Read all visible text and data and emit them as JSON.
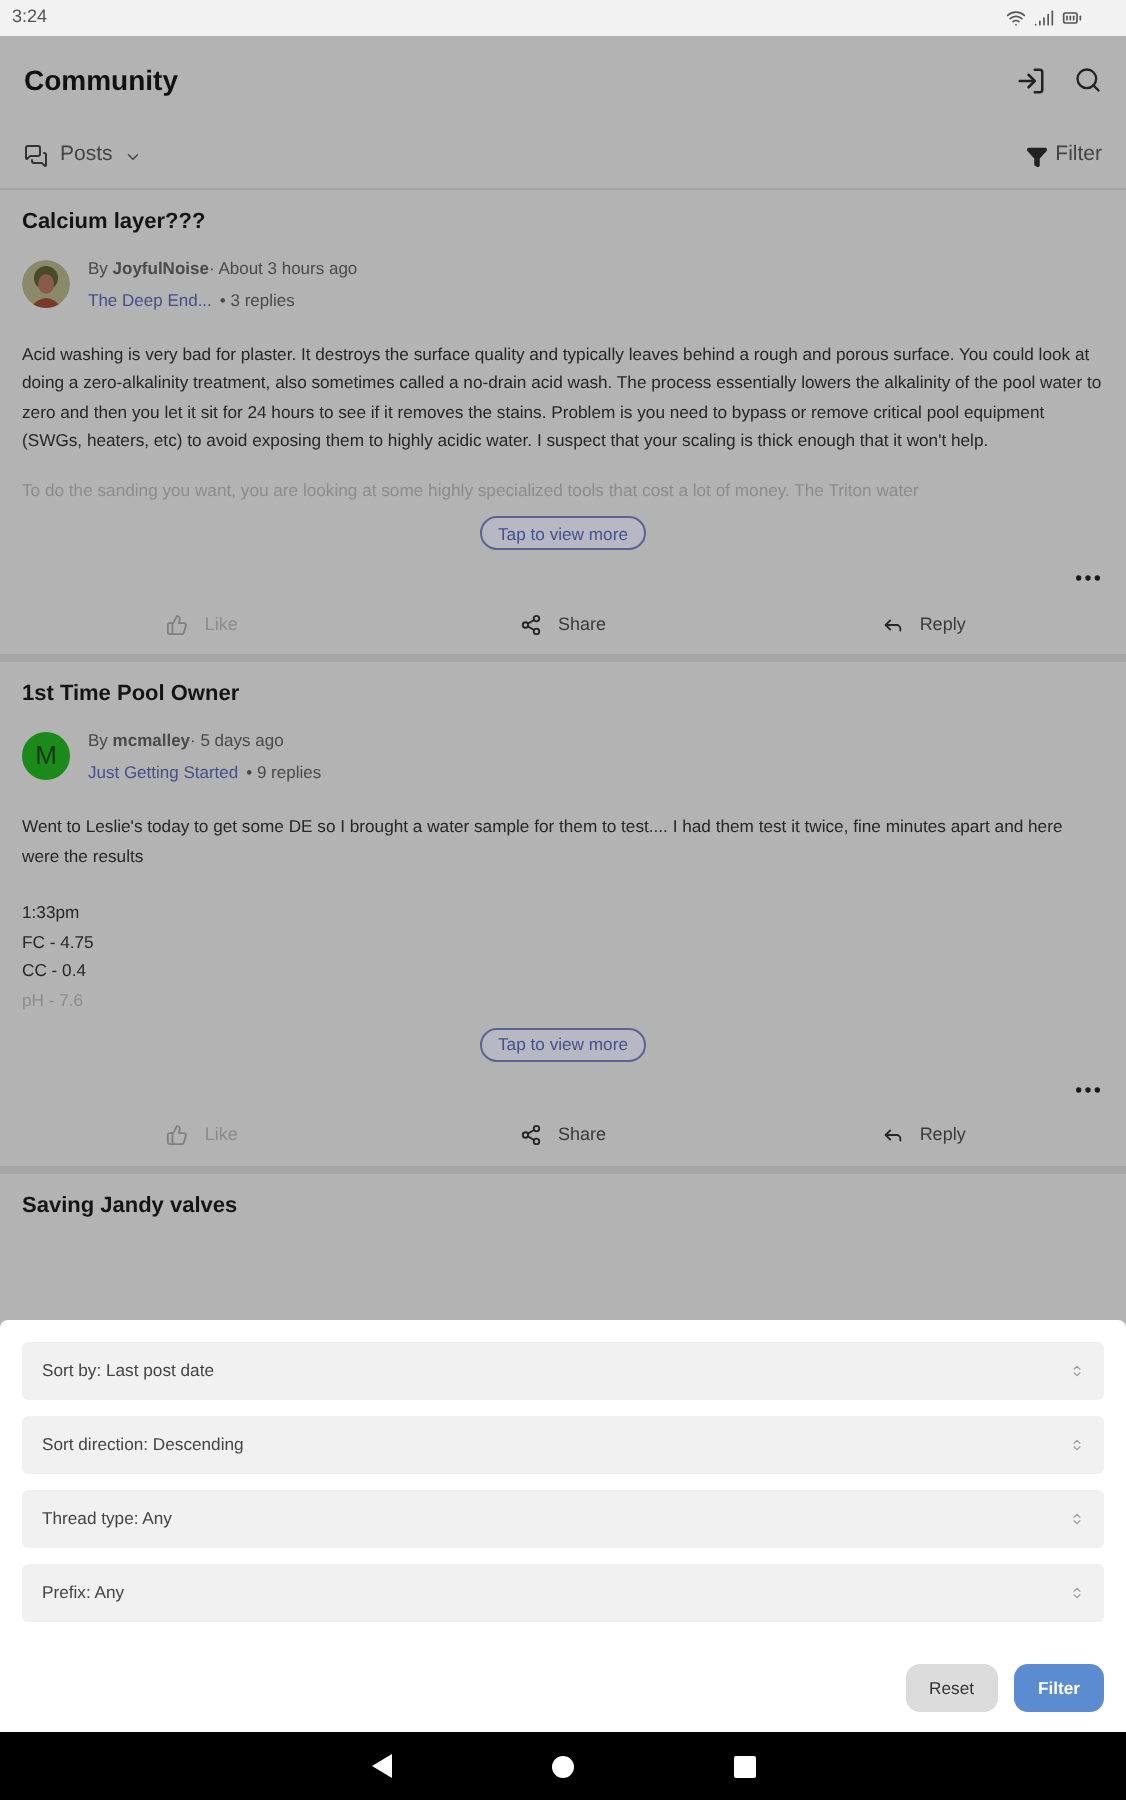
{
  "status_bar": {
    "time": "3:24"
  },
  "app_bar": {
    "title": "Community"
  },
  "toolbar": {
    "view_label": "Posts",
    "filter_label": "Filter"
  },
  "posts": [
    {
      "title": "Calcium layer???",
      "avatar": {
        "kind": "picture"
      },
      "meta": "By **JoyfulNoise**· About 3 hours ago",
      "forum": "The Deep End...",
      "replies": "• 3 replies",
      "paragraphs": [
        "Acid washing is very bad for plaster. It destroys the surface quality and typically leaves behind a rough and porous surface. You could look at doing a zero-alkalinity treatment, also sometimes called a no-drain acid wash. The process essentially lowers the alkalinity of the pool water to zero and then you let it sit for 24 hours to see if it removes the stains. Problem is you need to bypass or remove critical pool equipment (SWGs, heaters, etc) to avoid exposing them to highly acidic water. I suspect that your scaling is thick enough that it won't help."
      ],
      "faded_lines": [
        "To do the sanding you want, you are looking at some highly specialized tools that cost a lot of money. The Triton water"
      ],
      "more_label": "Tap to view more",
      "actions": [
        {
          "kind": "like",
          "label": "Like",
          "disabled": true
        },
        {
          "kind": "share",
          "label": "Share",
          "disabled": false
        },
        {
          "kind": "reply",
          "label": "Reply",
          "disabled": false
        }
      ]
    },
    {
      "title": "1st Time Pool Owner",
      "avatar": {
        "kind": "letter",
        "letter": "M",
        "color": "#1b8a1b"
      },
      "meta": "By **mcmalley**· 5 days ago",
      "forum": "Just Getting Started",
      "replies": "• 9 replies",
      "paragraphs": [
        "Went to Leslie's today to get some DE so I brought a water sample for them to test.... I had them test it twice, fine minutes apart and here were the results"
      ],
      "lines": [
        "1:33pm",
        "FC - 4.75",
        "CC - 0.4"
      ],
      "faded_lines": [
        "pH - 7.6"
      ],
      "more_label": "Tap to view more",
      "actions": [
        {
          "kind": "like",
          "label": "Like",
          "disabled": true
        },
        {
          "kind": "share",
          "label": "Share",
          "disabled": false
        },
        {
          "kind": "reply",
          "label": "Reply",
          "disabled": false
        }
      ]
    },
    {
      "title": "Saving Jandy valves"
    }
  ],
  "filter_sheet": {
    "selects": [
      {
        "label": "Sort by: Last post date"
      },
      {
        "label": "Sort direction: Descending"
      },
      {
        "label": "Thread type: Any"
      },
      {
        "label": "Prefix: Any"
      }
    ],
    "buttons": [
      {
        "kind": "secondary",
        "label": "Reset"
      },
      {
        "kind": "primary",
        "label": "Filter"
      }
    ]
  }
}
